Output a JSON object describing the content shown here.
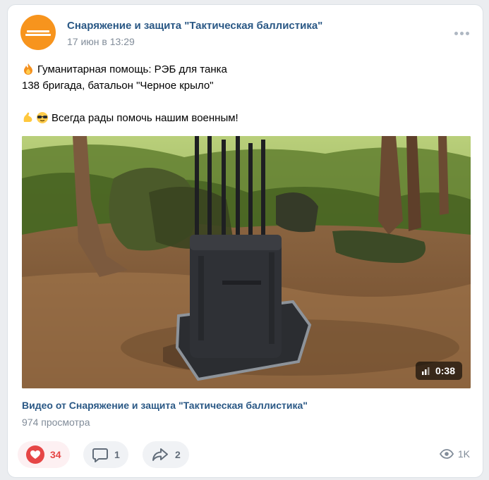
{
  "post": {
    "group_name": "Снаряжение и защита \"Тактическая баллистика\"",
    "date": "17 июн в 13:29",
    "text_lines": [
      "Гуманитарная помощь: РЭБ для танка",
      "138 бригада, батальон \"Черное крыло\"",
      "",
      "Всегда рады помочь нашим военным!"
    ],
    "line_emojis": [
      "fire-emoji",
      "",
      "",
      "muscle-sunglasses-emoji"
    ]
  },
  "video": {
    "duration": "0:38",
    "title": "Видео от Снаряжение и защита \"Тактическая баллистика\"",
    "views": "974 просмотра"
  },
  "actions": {
    "likes": "34",
    "comments": "1",
    "shares": "2",
    "views": "1K"
  },
  "colors": {
    "link": "#2a5885",
    "muted": "#818c99",
    "like": "#e64646",
    "avatar_bg": "#f7941d"
  }
}
